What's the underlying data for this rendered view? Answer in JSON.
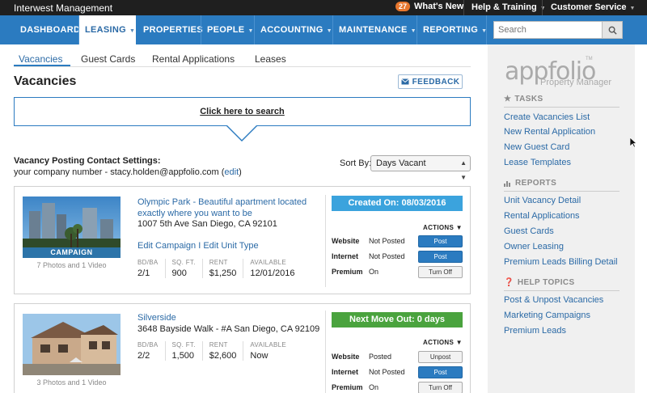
{
  "topbar": {
    "company": "Interwest Management",
    "whats_new_count": "27",
    "whats_new_label": "What's New",
    "help_label": "Help & Training",
    "customer_service_label": "Customer Service"
  },
  "nav": {
    "items": [
      {
        "label": "DASHBOARD"
      },
      {
        "label": "LEASING"
      },
      {
        "label": "PROPERTIES"
      },
      {
        "label": "PEOPLE"
      },
      {
        "label": "ACCOUNTING"
      },
      {
        "label": "MAINTENANCE"
      },
      {
        "label": "REPORTING"
      }
    ],
    "search_placeholder": "Search"
  },
  "tabs": [
    "Vacancies",
    "Guest Cards",
    "Rental Applications",
    "Leases"
  ],
  "page": {
    "title": "Vacancies",
    "feedback_label": "FEEDBACK",
    "search_link": "Click here to search",
    "contact_title": "Vacancy Posting Contact Settings:",
    "contact_text": "your company number - stacy.holden@appfolio.com (",
    "contact_edit": "edit",
    "contact_close": ")",
    "sort_label": "Sort By:",
    "sort_value": "Days Vacant"
  },
  "listings": [
    {
      "photo_caption": "7 Photos and 1 Video",
      "campaign_label": "CAMPAIGN",
      "title": "Olympic Park - Beautiful apartment located exactly where you want to be",
      "address": "1007 5th Ave San Diego, CA 92101",
      "links": "Edit Campaign I Edit Unit Type",
      "stats": [
        {
          "label": "BD/BA",
          "value": "2/1"
        },
        {
          "label": "SQ. FT.",
          "value": "900"
        },
        {
          "label": "RENT",
          "value": "$1,250"
        },
        {
          "label": "AVAILABLE",
          "value": "12/01/2016"
        }
      ],
      "status": "Created On: 08/03/2016",
      "actions_label": "ACTIONS",
      "channels": [
        {
          "name": "Website",
          "state": "Not Posted",
          "button": "Post"
        },
        {
          "name": "Internet",
          "state": "Not Posted",
          "button": "Post"
        },
        {
          "name": "Premium",
          "state": "On",
          "button": "Turn Off"
        }
      ]
    },
    {
      "photo_caption": "3 Photos and 1 Video",
      "title": "Silverside",
      "address": "3648 Bayside Walk - #A San Diego, CA 92109",
      "stats": [
        {
          "label": "BD/BA",
          "value": "2/2"
        },
        {
          "label": "SQ. FT.",
          "value": "1,500"
        },
        {
          "label": "RENT",
          "value": "$2,600"
        },
        {
          "label": "AVAILABLE",
          "value": "Now"
        }
      ],
      "status": "Next Move Out: 0 days",
      "actions_label": "ACTIONS",
      "channels": [
        {
          "name": "Website",
          "state": "Posted",
          "button": "Unpost"
        },
        {
          "name": "Internet",
          "state": "Not Posted",
          "button": "Post"
        },
        {
          "name": "Premium",
          "state": "On",
          "button": "Turn Off"
        }
      ]
    }
  ],
  "sidebar": {
    "logo": "appfolio",
    "logo_tm": "TM",
    "logo_sub": "Property Manager",
    "tasks_title": "TASKS",
    "tasks": [
      "Create Vacancies List",
      "New Rental Application",
      "New Guest Card",
      "Lease Templates"
    ],
    "reports_title": "REPORTS",
    "reports": [
      "Unit Vacancy Detail",
      "Rental Applications",
      "Guest Cards",
      "Owner Leasing",
      "Premium Leads Billing Detail"
    ],
    "help_title": "HELP TOPICS",
    "help": [
      "Post & Unpost Vacancies",
      "Marketing Campaigns",
      "Premium Leads"
    ]
  },
  "colors": {
    "nav_blue": "#2b7bc0",
    "link_blue": "#2b6aa6",
    "status_blue": "#3ba3dd",
    "status_green": "#4aa33e",
    "badge_orange": "#e8772e"
  }
}
